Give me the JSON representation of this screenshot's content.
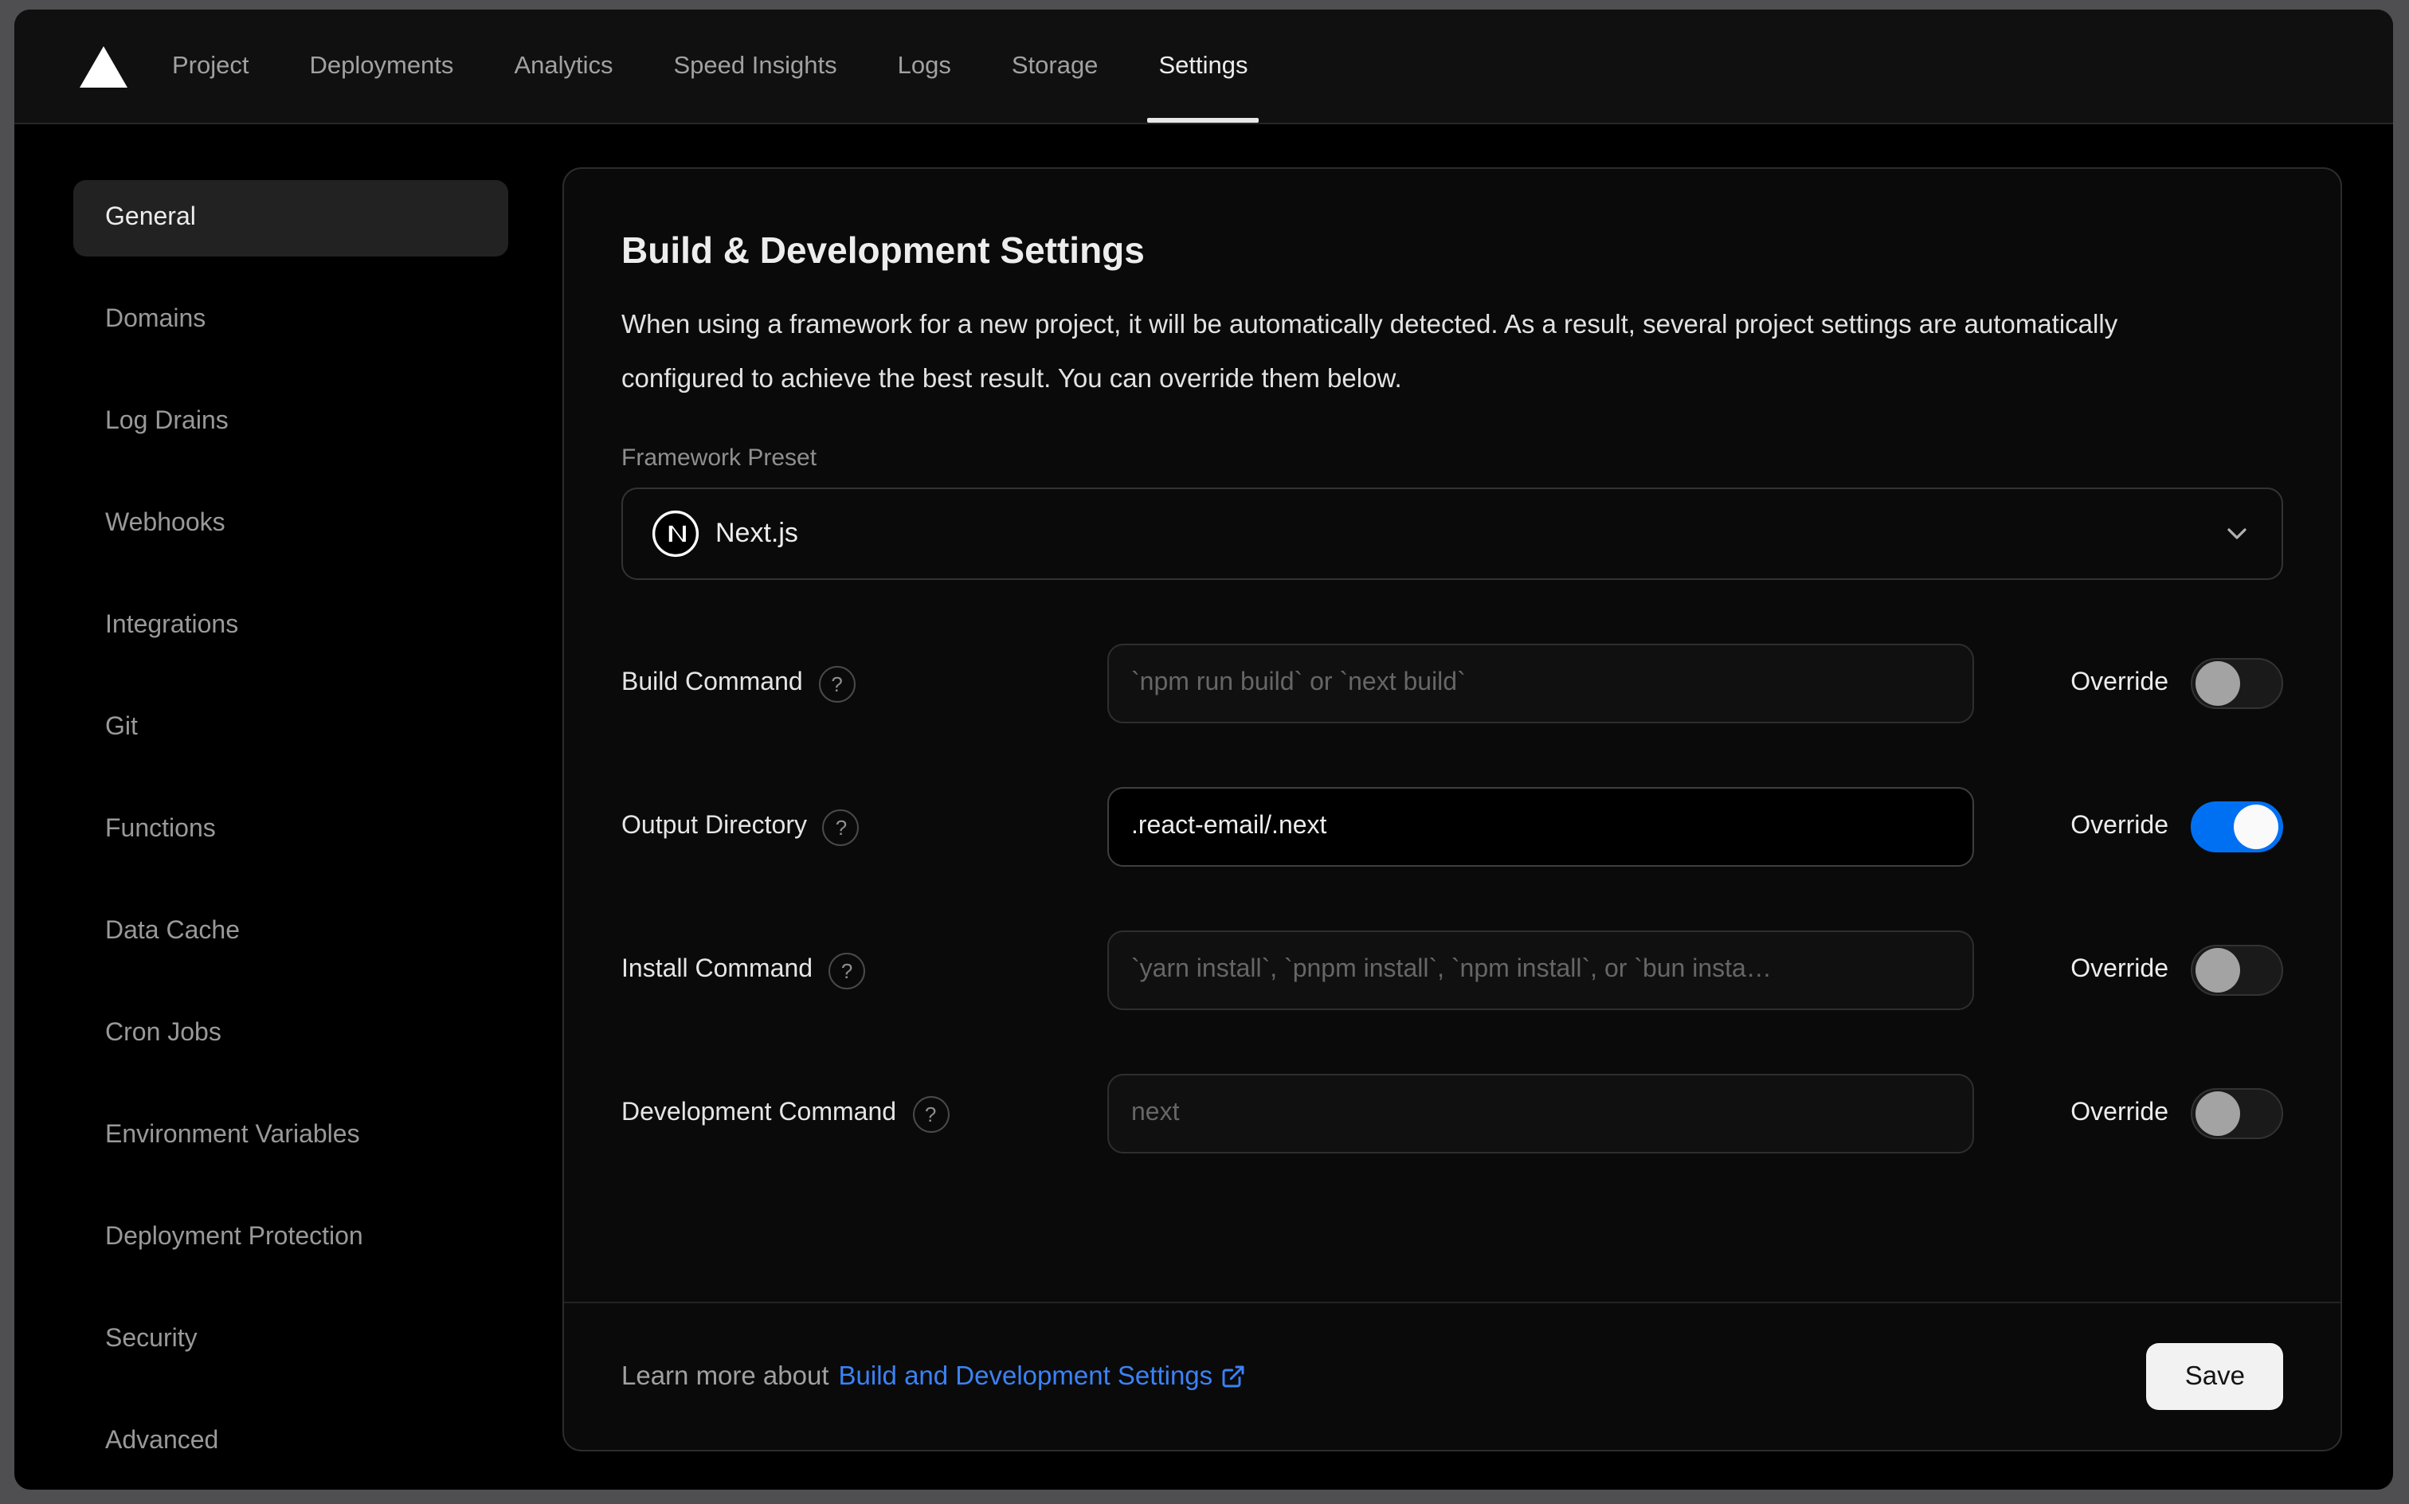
{
  "nav": {
    "logo_icon": "vercel-triangle-logo",
    "items": [
      {
        "label": "Project",
        "active": false
      },
      {
        "label": "Deployments",
        "active": false
      },
      {
        "label": "Analytics",
        "active": false
      },
      {
        "label": "Speed Insights",
        "active": false
      },
      {
        "label": "Logs",
        "active": false
      },
      {
        "label": "Storage",
        "active": false
      },
      {
        "label": "Settings",
        "active": true
      }
    ]
  },
  "sidebar": {
    "items": [
      {
        "label": "General",
        "active": true
      },
      {
        "label": "Domains",
        "active": false
      },
      {
        "label": "Log Drains",
        "active": false
      },
      {
        "label": "Webhooks",
        "active": false
      },
      {
        "label": "Integrations",
        "active": false
      },
      {
        "label": "Git",
        "active": false
      },
      {
        "label": "Functions",
        "active": false
      },
      {
        "label": "Data Cache",
        "active": false
      },
      {
        "label": "Cron Jobs",
        "active": false
      },
      {
        "label": "Environment Variables",
        "active": false
      },
      {
        "label": "Deployment Protection",
        "active": false
      },
      {
        "label": "Security",
        "active": false
      },
      {
        "label": "Advanced",
        "active": false
      }
    ]
  },
  "panel": {
    "title": "Build & Development Settings",
    "description": "When using a framework for a new project, it will be automatically detected. As a result, several project settings are automatically configured to achieve the best result. You can override them below.",
    "framework_preset": {
      "label": "Framework Preset",
      "value": "Next.js",
      "icon": "nextjs-logo",
      "chevron_icon": "chevron-down-icon"
    },
    "override_label": "Override",
    "rows": [
      {
        "label": "Build Command",
        "placeholder": "`npm run build` or `next build`",
        "value": "",
        "override_on": false
      },
      {
        "label": "Output Directory",
        "placeholder": "",
        "value": ".react-email/.next",
        "override_on": true
      },
      {
        "label": "Install Command",
        "placeholder": "`yarn install`, `pnpm install`, `npm install`, or `bun insta…",
        "value": "",
        "override_on": false
      },
      {
        "label": "Development Command",
        "placeholder": "next",
        "value": "",
        "override_on": false
      }
    ],
    "footer": {
      "learn_more_prefix": "Learn more about",
      "link_text": "Build and Development Settings",
      "external_link_icon": "external-link-icon",
      "save_label": "Save"
    }
  },
  "colors": {
    "toggle_on_blue": "#0070f3",
    "link_blue": "#3b82f6",
    "backdrop_gray": "#4f4f52",
    "save_button_bg": "#f2f2f2"
  }
}
